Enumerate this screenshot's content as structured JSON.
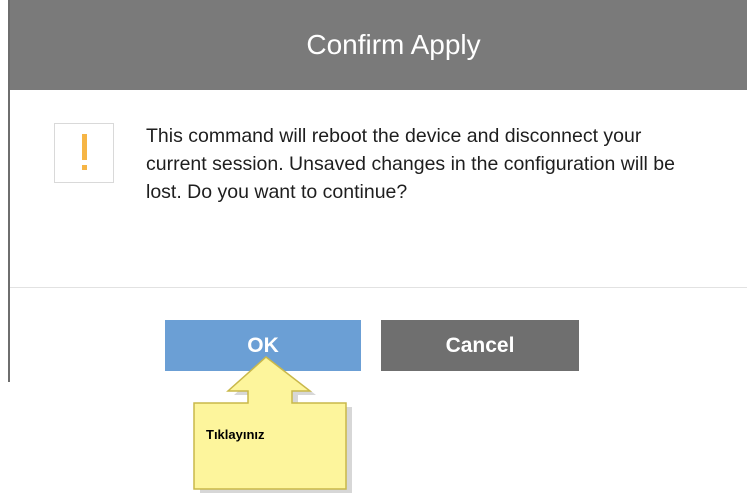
{
  "dialog": {
    "title": "Confirm Apply",
    "message": "This command will reboot the device and disconnect your current session. Unsaved changes in the configuration will be lost. Do you want to continue?",
    "icon": "warning-icon",
    "buttons": {
      "ok_label": "OK",
      "cancel_label": "Cancel"
    }
  },
  "callout": {
    "text": "Tıklayınız"
  },
  "colors": {
    "titlebar": "#7a7a7a",
    "ok_button": "#6b9fd5",
    "cancel_button": "#6f6f6f",
    "warning": "#f6b545",
    "callout_fill": "#fdf59c"
  }
}
